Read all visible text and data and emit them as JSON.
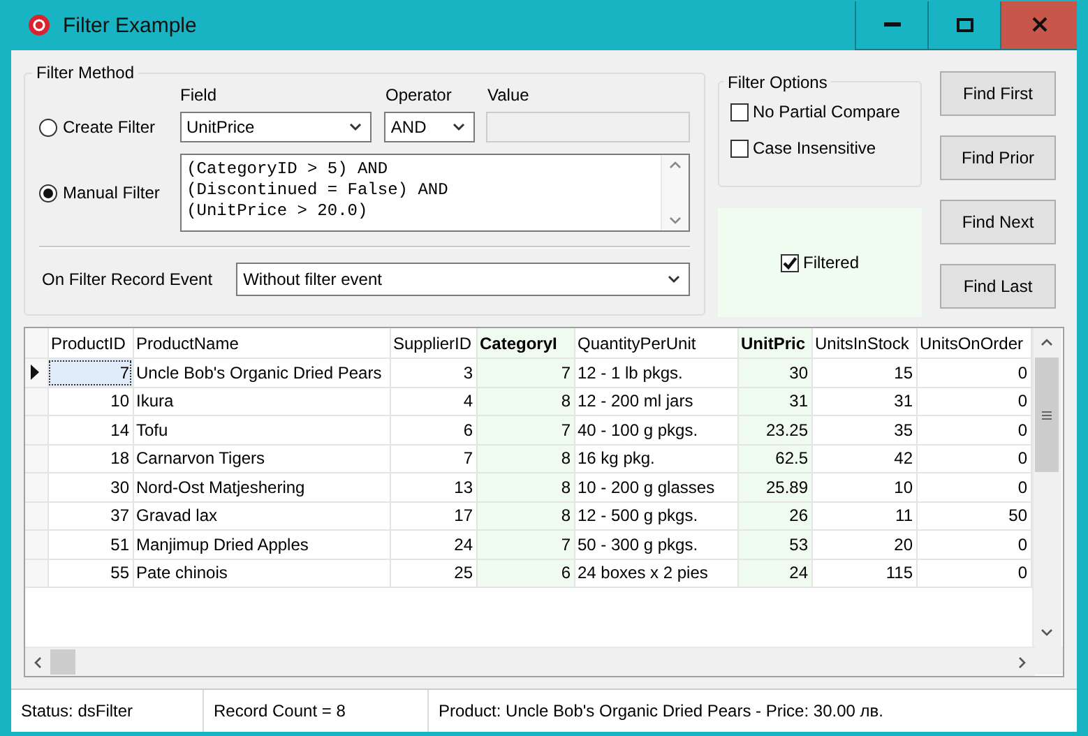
{
  "window": {
    "title": "Filter Example"
  },
  "filter_method": {
    "title": "Filter Method",
    "field_label": "Field",
    "operator_label": "Operator",
    "value_label": "Value",
    "options": [
      {
        "label": "Create Filter",
        "selected": false
      },
      {
        "label": "Manual Filter",
        "selected": true
      }
    ],
    "field_value": "UnitPrice",
    "operator_value": "AND",
    "manual_filter_lines": [
      "(CategoryID > 5) AND",
      "(Discontinued = False) AND",
      "(UnitPrice > 20.0)"
    ],
    "event_label": "On Filter Record Event",
    "event_value": "Without filter event"
  },
  "filter_options": {
    "title": "Filter Options",
    "checkboxes": [
      {
        "label": "No Partial Compare",
        "checked": false
      },
      {
        "label": "Case Insensitive",
        "checked": false
      }
    ]
  },
  "filtered": {
    "label": "Filtered",
    "checked": true
  },
  "buttons": [
    "Find First",
    "Find Prior",
    "Find Next",
    "Find Last"
  ],
  "table": {
    "columns": [
      {
        "label": "ProductID",
        "kind": "number",
        "highlighted": false
      },
      {
        "label": "ProductName",
        "kind": "text",
        "highlighted": false
      },
      {
        "label": "SupplierID",
        "kind": "number",
        "highlighted": false
      },
      {
        "label": "CategoryI",
        "kind": "number",
        "highlighted": true
      },
      {
        "label": "QuantityPerUnit",
        "kind": "text",
        "highlighted": false
      },
      {
        "label": "UnitPric",
        "kind": "number",
        "highlighted": true
      },
      {
        "label": "UnitsInStock",
        "kind": "number",
        "highlighted": false
      },
      {
        "label": "UnitsOnOrder",
        "kind": "number",
        "highlighted": false
      }
    ],
    "rows": [
      {
        "selected": true,
        "cells": [
          "7",
          "Uncle Bob's Organic Dried Pears",
          "3",
          "7",
          "12 - 1 lb pkgs.",
          "30",
          "15",
          "0"
        ]
      },
      {
        "selected": false,
        "cells": [
          "10",
          "Ikura",
          "4",
          "8",
          "12 - 200 ml jars",
          "31",
          "31",
          "0"
        ]
      },
      {
        "selected": false,
        "cells": [
          "14",
          "Tofu",
          "6",
          "7",
          "40 - 100 g pkgs.",
          "23.25",
          "35",
          "0"
        ]
      },
      {
        "selected": false,
        "cells": [
          "18",
          "Carnarvon Tigers",
          "7",
          "8",
          "16 kg pkg.",
          "62.5",
          "42",
          "0"
        ]
      },
      {
        "selected": false,
        "cells": [
          "30",
          "Nord-Ost Matjeshering",
          "13",
          "8",
          "10 - 200 g glasses",
          "25.89",
          "10",
          "0"
        ]
      },
      {
        "selected": false,
        "cells": [
          "37",
          "Gravad lax",
          "17",
          "8",
          "12 - 500 g pkgs.",
          "26",
          "11",
          "50"
        ]
      },
      {
        "selected": false,
        "cells": [
          "51",
          "Manjimup Dried Apples",
          "24",
          "7",
          "50 - 300 g pkgs.",
          "53",
          "20",
          "0"
        ]
      },
      {
        "selected": false,
        "cells": [
          "55",
          "Pate chinois",
          "25",
          "6",
          "24 boxes x 2 pies",
          "24",
          "115",
          "0"
        ]
      }
    ]
  },
  "status_bar": [
    "Status: dsFilter",
    "Record Count = 8",
    "Product: Uncle Bob's Organic Dried Pears - Price: 30.00 лв."
  ]
}
